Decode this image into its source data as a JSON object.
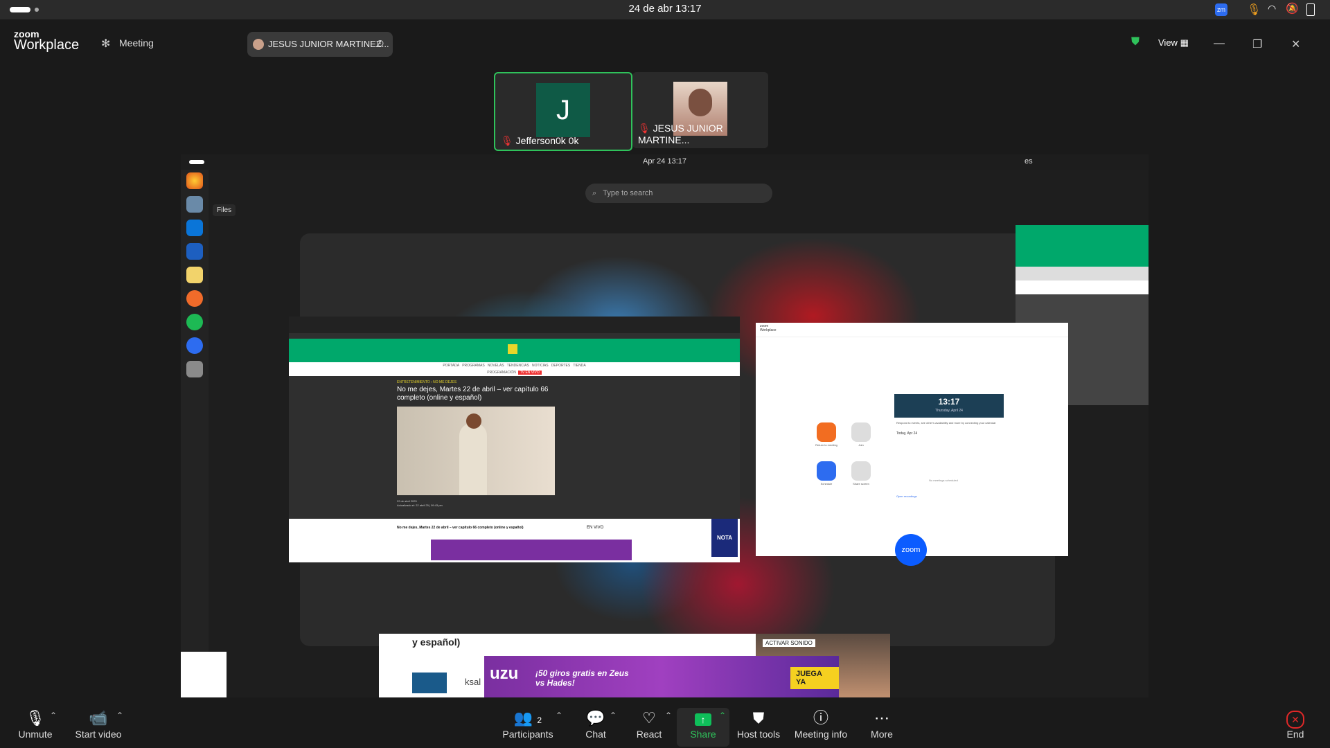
{
  "os_bar": {
    "clock": "24 de abr  13:17"
  },
  "zoom_header": {
    "brand_top": "zoom",
    "brand_bottom": "Workplace",
    "meeting_label": "Meeting",
    "host_name_chip": "JESUS JUNIOR MARTINEZ...",
    "view_label": "View"
  },
  "participants": [
    {
      "initial": "J",
      "name": "Jefferson0k 0k",
      "muted": true,
      "active_speaker": true
    },
    {
      "name": "JESUS JUNIOR MARTINE...",
      "muted": true,
      "active_speaker": false
    }
  ],
  "shared_screen": {
    "clock": "Apr 24  13:17",
    "lang": "es",
    "search_placeholder": "Type to search",
    "dock_tooltip": "Files",
    "browser_window": {
      "site_nav": [
        "PORTADA",
        "PROGRAMAS",
        "NOVELAS",
        "TENDENCIAS",
        "NOTICIAS",
        "DEPORTES",
        "TIENDA"
      ],
      "site_nav_row2": [
        "PROGRAMACIÓN",
        "TV EN VIVO"
      ],
      "breadcrumb": [
        "ENTRETENIMIENTO",
        "NO ME DEJES"
      ],
      "article_title": "No me dejes, Martes 22 de abril – ver capítulo 66 completo (online y español)",
      "date_line": "22 de abril 2025",
      "updated_line": "Actualizado el: 22 abril 25 | 09:43 pm",
      "footer_title": "No me dejes, Martes 22 de abril – ver capítulo 66 completo (online y español)",
      "live_label": "EN VIVO",
      "nota_badge": "NOTA"
    },
    "zoom_window": {
      "brand_top": "zoom",
      "brand_bottom": "Workplace",
      "clock": "13:17",
      "date": "Thursday, April 24",
      "calendar_text": "Respond to events, see other's availability and more by connecting your calendar",
      "today_label": "Today, Apr 24",
      "no_meetings": "No meetings scheduled",
      "open_recordings": "Open recordings",
      "zoom_badge": "zoom",
      "actions": [
        "Return to meeting",
        "Join",
        "Schedule",
        "Share screen"
      ]
    },
    "bottom_banner": {
      "heading": "y español)",
      "audio_label": "ACTIVAR SONIDO",
      "ad_brand": "uzu",
      "ad_text": "¡50 giros gratis en Zeus vs Hades!",
      "ad_cta": "JUEGA YA",
      "partial_name": "ksal"
    }
  },
  "controls": {
    "unmute": "Unmute",
    "start_video": "Start video",
    "participants": "Participants",
    "participants_count": "2",
    "chat": "Chat",
    "react": "React",
    "share": "Share",
    "host_tools": "Host tools",
    "meeting_info": "Meeting info",
    "more": "More",
    "end": "End"
  },
  "colors": {
    "accent_green": "#00a86b",
    "zoom_blue": "#0b5cff",
    "end_red": "#e02828"
  }
}
